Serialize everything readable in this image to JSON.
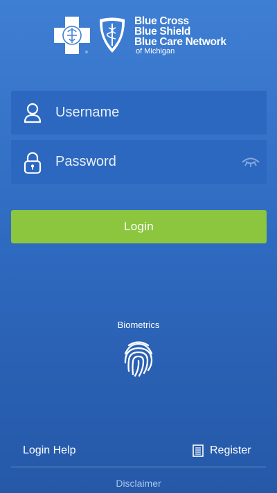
{
  "brand": {
    "line1": "Blue Cross",
    "line2": "Blue Shield",
    "line3": "Blue Care Network",
    "line4": "of Michigan"
  },
  "form": {
    "username_placeholder": "Username",
    "password_placeholder": "Password",
    "login_label": "Login"
  },
  "biometrics": {
    "label": "Biometrics"
  },
  "footer": {
    "help_label": "Login Help",
    "register_label": "Register",
    "disclaimer_label": "Disclaimer"
  },
  "colors": {
    "accent": "#8cc63f",
    "background": "#3272c9",
    "field": "#2d68c0"
  }
}
